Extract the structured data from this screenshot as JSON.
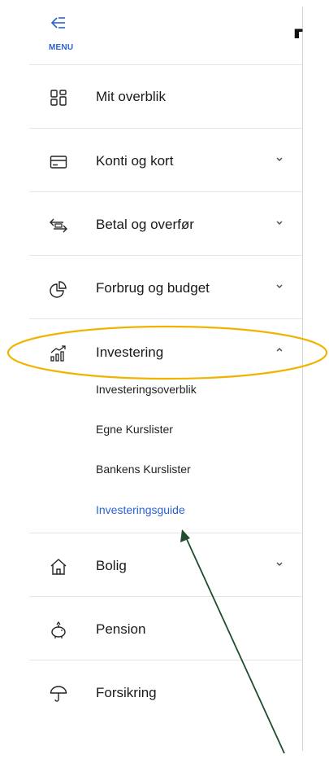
{
  "menu": {
    "toggle_label": "MENU"
  },
  "nav": {
    "items": [
      {
        "label": "Mit overblik",
        "icon": "dashboard-grid-icon"
      },
      {
        "label": "Konti og kort",
        "icon": "credit-card-icon",
        "expandable": true
      },
      {
        "label": "Betal og overfør",
        "icon": "transfer-arrows-icon",
        "expandable": true
      },
      {
        "label": "Forbrug og budget",
        "icon": "pie-chart-icon",
        "expandable": true
      },
      {
        "label": "Investering",
        "icon": "investment-chart-icon",
        "expandable": true,
        "expanded": true,
        "children": [
          {
            "label": "Investeringsoverblik"
          },
          {
            "label": "Egne Kurslister"
          },
          {
            "label": "Bankens Kurslister"
          },
          {
            "label": "Investeringsguide",
            "active": true
          }
        ]
      },
      {
        "label": "Bolig",
        "icon": "house-icon",
        "expandable": true
      },
      {
        "label": "Pension",
        "icon": "piggy-bank-icon"
      },
      {
        "label": "Forsikring",
        "icon": "umbrella-icon"
      }
    ]
  },
  "colors": {
    "accent": "#2a62d4",
    "highlight": "#f0b400",
    "annotation_arrow": "#1f4d2e"
  }
}
